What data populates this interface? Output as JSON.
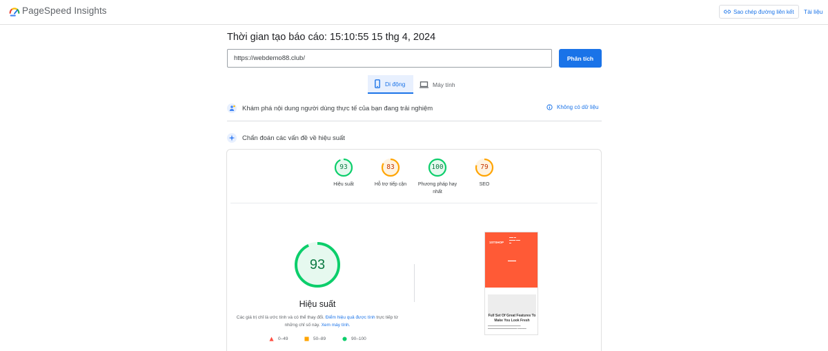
{
  "header": {
    "brand": "PageSpeed Insights",
    "copy_link_label": "Sao chép đường liên kết",
    "docs_label": "Tài liệu",
    "brand_colors": [
      "#ea4335",
      "#fbbc04",
      "#34a853",
      "#4285f4"
    ]
  },
  "report": {
    "title": "Thời gian tạo báo cáo: 15:10:55 15 thg 4, 2024",
    "url_value": "https://webdemo88.club/",
    "analyze_label": "Phân tích"
  },
  "tabs": [
    {
      "label": "Di động",
      "icon": "mobile-icon",
      "active": true
    },
    {
      "label": "Máy tính",
      "icon": "laptop-icon",
      "active": false
    }
  ],
  "field_data": {
    "label": "Khám phá nội dung người dùng thực tế của bạn đang trải nghiệm",
    "no_data_label": "Không có dữ liệu"
  },
  "diagnose": {
    "label": "Chẩn đoán các vấn đề về hiệu suất"
  },
  "scores": [
    {
      "value": 93,
      "label": "Hiệu suất",
      "status": "pass"
    },
    {
      "value": 83,
      "label": "Hỗ trợ tiếp cận",
      "status": "average"
    },
    {
      "value": 100,
      "label": "Phương pháp hay nhất",
      "status": "pass"
    },
    {
      "value": 79,
      "label": "SEO",
      "status": "average"
    }
  ],
  "performance": {
    "score": 93,
    "label": "Hiệu suất",
    "note_prefix": "Các giá trị chỉ là ước tính và có thể thay đổi.",
    "note_link1": "Điểm hiệu quả được tính",
    "note_middle": "trực tiếp từ những chỉ số này.",
    "note_link2": "Xem máy tính."
  },
  "legend": [
    {
      "range": "0–49",
      "shape": "triangle",
      "color": "#ff4e42"
    },
    {
      "range": "50–89",
      "shape": "square",
      "color": "#ffa400"
    },
    {
      "range": "90–100",
      "shape": "circle",
      "color": "#0cce6b"
    }
  ],
  "colors": {
    "accent": "#1a73e8",
    "pass": "#0cce6b",
    "pass_text": "#0c7a43",
    "pass_bg": "#e6f9ef",
    "average": "#ffa400",
    "average_text": "#c33300",
    "average_bg": "#fff3e0"
  },
  "screenshot": {
    "logo": "1STSHOP",
    "headline": "Full Set Of Great Features To Make You Look Fresh"
  }
}
